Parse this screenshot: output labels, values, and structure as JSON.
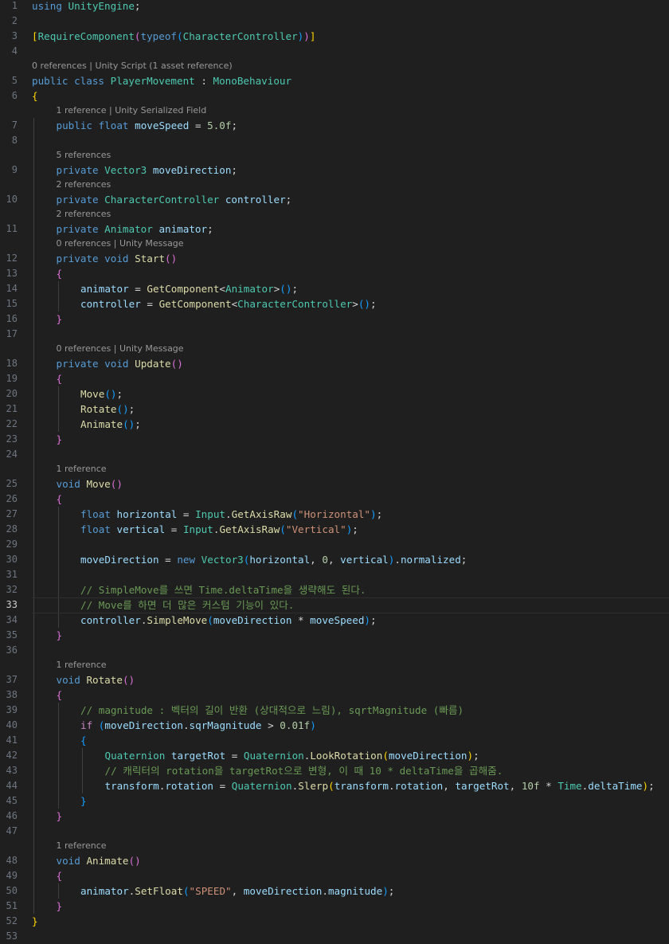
{
  "editor": {
    "language": "csharp",
    "file_name": "PlayerMovement.cs",
    "active_line": 33,
    "colors": {
      "background": "#1f1f1f",
      "keyword": "#569cd6",
      "type": "#4ec9b0",
      "function": "#dcdcaa",
      "variable": "#9cdcfe",
      "string": "#ce9178",
      "number": "#b5cea8",
      "comment": "#6a9955",
      "bracket1": "#ffd700",
      "bracket2": "#da70d6",
      "bracket3": "#179fff"
    },
    "codelens": [
      {
        "line": 5,
        "text": "0 references | Unity Script (1 asset reference)"
      },
      {
        "line": 7,
        "text": "1 reference | Unity Serialized Field"
      },
      {
        "line": 9,
        "text": "5 references"
      },
      {
        "line": 10,
        "text": "2 references"
      },
      {
        "line": 11,
        "text": "2 references"
      },
      {
        "line": 12,
        "text": "0 references | Unity Message"
      },
      {
        "line": 18,
        "text": "0 references | Unity Message"
      },
      {
        "line": 25,
        "text": "1 reference"
      },
      {
        "line": 37,
        "text": "1 reference"
      },
      {
        "line": 48,
        "text": "1 reference"
      }
    ],
    "lines": [
      {
        "n": 1,
        "indent": 0,
        "tokens": [
          [
            "kw",
            "using"
          ],
          [
            "pun",
            " "
          ],
          [
            "ty",
            "UnityEngine"
          ],
          [
            "pun",
            ";"
          ]
        ]
      },
      {
        "n": 2,
        "indent": 0,
        "tokens": []
      },
      {
        "n": 3,
        "indent": 0,
        "tokens": [
          [
            "br1",
            "["
          ],
          [
            "ty",
            "RequireComponent"
          ],
          [
            "br2",
            "("
          ],
          [
            "kw",
            "typeof"
          ],
          [
            "br3",
            "("
          ],
          [
            "ty",
            "CharacterController"
          ],
          [
            "br3",
            ")"
          ],
          [
            "br2",
            ")"
          ],
          [
            "br1",
            "]"
          ]
        ]
      },
      {
        "n": 4,
        "indent": 0,
        "tokens": []
      },
      {
        "n": 5,
        "indent": 0,
        "tokens": [
          [
            "kw",
            "public"
          ],
          [
            "pun",
            " "
          ],
          [
            "kw",
            "class"
          ],
          [
            "pun",
            " "
          ],
          [
            "ty",
            "PlayerMovement"
          ],
          [
            "pun",
            " : "
          ],
          [
            "ty",
            "MonoBehaviour"
          ]
        ]
      },
      {
        "n": 6,
        "indent": 0,
        "tokens": [
          [
            "br1",
            "{"
          ]
        ]
      },
      {
        "n": 7,
        "indent": 1,
        "tokens": [
          [
            "kw",
            "public"
          ],
          [
            "pun",
            " "
          ],
          [
            "kw",
            "float"
          ],
          [
            "pun",
            " "
          ],
          [
            "var",
            "moveSpeed"
          ],
          [
            "pun",
            " = "
          ],
          [
            "num",
            "5.0f"
          ],
          [
            "pun",
            ";"
          ]
        ]
      },
      {
        "n": 8,
        "indent": 0,
        "tokens": []
      },
      {
        "n": 9,
        "indent": 1,
        "tokens": [
          [
            "kw",
            "private"
          ],
          [
            "pun",
            " "
          ],
          [
            "ty",
            "Vector3"
          ],
          [
            "pun",
            " "
          ],
          [
            "var",
            "moveDirection"
          ],
          [
            "pun",
            ";"
          ]
        ]
      },
      {
        "n": 10,
        "indent": 1,
        "tokens": [
          [
            "kw",
            "private"
          ],
          [
            "pun",
            " "
          ],
          [
            "ty",
            "CharacterController"
          ],
          [
            "pun",
            " "
          ],
          [
            "var",
            "controller"
          ],
          [
            "pun",
            ";"
          ]
        ]
      },
      {
        "n": 11,
        "indent": 1,
        "tokens": [
          [
            "kw",
            "private"
          ],
          [
            "pun",
            " "
          ],
          [
            "ty",
            "Animator"
          ],
          [
            "pun",
            " "
          ],
          [
            "var",
            "animator"
          ],
          [
            "pun",
            ";"
          ]
        ]
      },
      {
        "n": 12,
        "indent": 1,
        "tokens": [
          [
            "kw",
            "private"
          ],
          [
            "pun",
            " "
          ],
          [
            "kw",
            "void"
          ],
          [
            "pun",
            " "
          ],
          [
            "fn",
            "Start"
          ],
          [
            "br2",
            "()"
          ]
        ]
      },
      {
        "n": 13,
        "indent": 1,
        "tokens": [
          [
            "br2",
            "{"
          ]
        ]
      },
      {
        "n": 14,
        "indent": 2,
        "tokens": [
          [
            "var",
            "animator"
          ],
          [
            "pun",
            " = "
          ],
          [
            "fn",
            "GetComponent"
          ],
          [
            "pun",
            "<"
          ],
          [
            "ty",
            "Animator"
          ],
          [
            "pun",
            ">"
          ],
          [
            "br3",
            "()"
          ],
          [
            "pun",
            ";"
          ]
        ]
      },
      {
        "n": 15,
        "indent": 2,
        "tokens": [
          [
            "var",
            "controller"
          ],
          [
            "pun",
            " = "
          ],
          [
            "fn",
            "GetComponent"
          ],
          [
            "pun",
            "<"
          ],
          [
            "ty",
            "CharacterController"
          ],
          [
            "pun",
            ">"
          ],
          [
            "br3",
            "()"
          ],
          [
            "pun",
            ";"
          ]
        ]
      },
      {
        "n": 16,
        "indent": 1,
        "tokens": [
          [
            "br2",
            "}"
          ]
        ]
      },
      {
        "n": 17,
        "indent": 0,
        "tokens": []
      },
      {
        "n": 18,
        "indent": 1,
        "tokens": [
          [
            "kw",
            "private"
          ],
          [
            "pun",
            " "
          ],
          [
            "kw",
            "void"
          ],
          [
            "pun",
            " "
          ],
          [
            "fn",
            "Update"
          ],
          [
            "br2",
            "()"
          ]
        ]
      },
      {
        "n": 19,
        "indent": 1,
        "tokens": [
          [
            "br2",
            "{"
          ]
        ]
      },
      {
        "n": 20,
        "indent": 2,
        "tokens": [
          [
            "fn",
            "Move"
          ],
          [
            "br3",
            "()"
          ],
          [
            "pun",
            ";"
          ]
        ]
      },
      {
        "n": 21,
        "indent": 2,
        "tokens": [
          [
            "fn",
            "Rotate"
          ],
          [
            "br3",
            "()"
          ],
          [
            "pun",
            ";"
          ]
        ]
      },
      {
        "n": 22,
        "indent": 2,
        "tokens": [
          [
            "fn",
            "Animate"
          ],
          [
            "br3",
            "()"
          ],
          [
            "pun",
            ";"
          ]
        ]
      },
      {
        "n": 23,
        "indent": 1,
        "tokens": [
          [
            "br2",
            "}"
          ]
        ]
      },
      {
        "n": 24,
        "indent": 0,
        "tokens": []
      },
      {
        "n": 25,
        "indent": 1,
        "tokens": [
          [
            "kw",
            "void"
          ],
          [
            "pun",
            " "
          ],
          [
            "fn",
            "Move"
          ],
          [
            "br2",
            "()"
          ]
        ]
      },
      {
        "n": 26,
        "indent": 1,
        "tokens": [
          [
            "br2",
            "{"
          ]
        ]
      },
      {
        "n": 27,
        "indent": 2,
        "tokens": [
          [
            "kw",
            "float"
          ],
          [
            "pun",
            " "
          ],
          [
            "var",
            "horizontal"
          ],
          [
            "pun",
            " = "
          ],
          [
            "ty",
            "Input"
          ],
          [
            "pun",
            "."
          ],
          [
            "fn",
            "GetAxisRaw"
          ],
          [
            "br3",
            "("
          ],
          [
            "str",
            "\"Horizontal\""
          ],
          [
            "br3",
            ")"
          ],
          [
            "pun",
            ";"
          ]
        ]
      },
      {
        "n": 28,
        "indent": 2,
        "tokens": [
          [
            "kw",
            "float"
          ],
          [
            "pun",
            " "
          ],
          [
            "var",
            "vertical"
          ],
          [
            "pun",
            " = "
          ],
          [
            "ty",
            "Input"
          ],
          [
            "pun",
            "."
          ],
          [
            "fn",
            "GetAxisRaw"
          ],
          [
            "br3",
            "("
          ],
          [
            "str",
            "\"Vertical\""
          ],
          [
            "br3",
            ")"
          ],
          [
            "pun",
            ";"
          ]
        ]
      },
      {
        "n": 29,
        "indent": 0,
        "tokens": []
      },
      {
        "n": 30,
        "indent": 2,
        "tokens": [
          [
            "var",
            "moveDirection"
          ],
          [
            "pun",
            " = "
          ],
          [
            "kw",
            "new"
          ],
          [
            "pun",
            " "
          ],
          [
            "ty",
            "Vector3"
          ],
          [
            "br3",
            "("
          ],
          [
            "var",
            "horizontal"
          ],
          [
            "pun",
            ", "
          ],
          [
            "num",
            "0"
          ],
          [
            "pun",
            ", "
          ],
          [
            "var",
            "vertical"
          ],
          [
            "br3",
            ")"
          ],
          [
            "pun",
            "."
          ],
          [
            "var",
            "normalized"
          ],
          [
            "pun",
            ";"
          ]
        ]
      },
      {
        "n": 31,
        "indent": 0,
        "tokens": []
      },
      {
        "n": 32,
        "indent": 2,
        "tokens": [
          [
            "com",
            "// SimpleMove를 쓰면 Time.deltaTime을 생략해도 된다."
          ]
        ]
      },
      {
        "n": 33,
        "indent": 2,
        "tokens": [
          [
            "com",
            "// Move를 하면 더 많은 커스텀 기능이 있다."
          ]
        ]
      },
      {
        "n": 34,
        "indent": 2,
        "tokens": [
          [
            "var",
            "controller"
          ],
          [
            "pun",
            "."
          ],
          [
            "fn",
            "SimpleMove"
          ],
          [
            "br3",
            "("
          ],
          [
            "var",
            "moveDirection"
          ],
          [
            "pun",
            " * "
          ],
          [
            "var",
            "moveSpeed"
          ],
          [
            "br3",
            ")"
          ],
          [
            "pun",
            ";"
          ]
        ]
      },
      {
        "n": 35,
        "indent": 1,
        "tokens": [
          [
            "br2",
            "}"
          ]
        ]
      },
      {
        "n": 36,
        "indent": 0,
        "tokens": []
      },
      {
        "n": 37,
        "indent": 1,
        "tokens": [
          [
            "kw",
            "void"
          ],
          [
            "pun",
            " "
          ],
          [
            "fn",
            "Rotate"
          ],
          [
            "br2",
            "()"
          ]
        ]
      },
      {
        "n": 38,
        "indent": 1,
        "tokens": [
          [
            "br2",
            "{"
          ]
        ]
      },
      {
        "n": 39,
        "indent": 2,
        "tokens": [
          [
            "com",
            "// magnitude : 벡터의 길이 반환 (상대적으로 느림), sqrtMagnitude (빠름)"
          ]
        ]
      },
      {
        "n": 40,
        "indent": 2,
        "tokens": [
          [
            "ctl",
            "if"
          ],
          [
            "pun",
            " "
          ],
          [
            "br3",
            "("
          ],
          [
            "var",
            "moveDirection"
          ],
          [
            "pun",
            "."
          ],
          [
            "var",
            "sqrMagnitude"
          ],
          [
            "pun",
            " > "
          ],
          [
            "num",
            "0.01f"
          ],
          [
            "br3",
            ")"
          ]
        ]
      },
      {
        "n": 41,
        "indent": 2,
        "tokens": [
          [
            "br3",
            "{"
          ]
        ]
      },
      {
        "n": 42,
        "indent": 3,
        "tokens": [
          [
            "ty",
            "Quaternion"
          ],
          [
            "pun",
            " "
          ],
          [
            "var",
            "targetRot"
          ],
          [
            "pun",
            " = "
          ],
          [
            "ty",
            "Quaternion"
          ],
          [
            "pun",
            "."
          ],
          [
            "fn",
            "LookRotation"
          ],
          [
            "br1",
            "("
          ],
          [
            "var",
            "moveDirection"
          ],
          [
            "br1",
            ")"
          ],
          [
            "pun",
            ";"
          ]
        ]
      },
      {
        "n": 43,
        "indent": 3,
        "tokens": [
          [
            "com",
            "// 캐릭터의 rotation을 targetRot으로 변형, 이 때 10 * deltaTime을 곱해줌."
          ]
        ]
      },
      {
        "n": 44,
        "indent": 3,
        "tokens": [
          [
            "var",
            "transform"
          ],
          [
            "pun",
            "."
          ],
          [
            "var",
            "rotation"
          ],
          [
            "pun",
            " = "
          ],
          [
            "ty",
            "Quaternion"
          ],
          [
            "pun",
            "."
          ],
          [
            "fn",
            "Slerp"
          ],
          [
            "br1",
            "("
          ],
          [
            "var",
            "transform"
          ],
          [
            "pun",
            "."
          ],
          [
            "var",
            "rotation"
          ],
          [
            "pun",
            ", "
          ],
          [
            "var",
            "targetRot"
          ],
          [
            "pun",
            ", "
          ],
          [
            "num",
            "10f"
          ],
          [
            "pun",
            " * "
          ],
          [
            "ty",
            "Time"
          ],
          [
            "pun",
            "."
          ],
          [
            "var",
            "deltaTime"
          ],
          [
            "br1",
            ")"
          ],
          [
            "pun",
            ";"
          ]
        ]
      },
      {
        "n": 45,
        "indent": 2,
        "tokens": [
          [
            "br3",
            "}"
          ]
        ]
      },
      {
        "n": 46,
        "indent": 1,
        "tokens": [
          [
            "br2",
            "}"
          ]
        ]
      },
      {
        "n": 47,
        "indent": 0,
        "tokens": []
      },
      {
        "n": 48,
        "indent": 1,
        "tokens": [
          [
            "kw",
            "void"
          ],
          [
            "pun",
            " "
          ],
          [
            "fn",
            "Animate"
          ],
          [
            "br2",
            "()"
          ]
        ]
      },
      {
        "n": 49,
        "indent": 1,
        "tokens": [
          [
            "br2",
            "{"
          ]
        ]
      },
      {
        "n": 50,
        "indent": 2,
        "tokens": [
          [
            "var",
            "animator"
          ],
          [
            "pun",
            "."
          ],
          [
            "fn",
            "SetFloat"
          ],
          [
            "br3",
            "("
          ],
          [
            "str",
            "\"SPEED\""
          ],
          [
            "pun",
            ", "
          ],
          [
            "var",
            "moveDirection"
          ],
          [
            "pun",
            "."
          ],
          [
            "var",
            "magnitude"
          ],
          [
            "br3",
            ")"
          ],
          [
            "pun",
            ";"
          ]
        ]
      },
      {
        "n": 51,
        "indent": 1,
        "tokens": [
          [
            "br2",
            "}"
          ]
        ]
      },
      {
        "n": 52,
        "indent": 0,
        "tokens": [
          [
            "br1",
            "}"
          ]
        ]
      },
      {
        "n": 53,
        "indent": 0,
        "tokens": []
      }
    ]
  }
}
